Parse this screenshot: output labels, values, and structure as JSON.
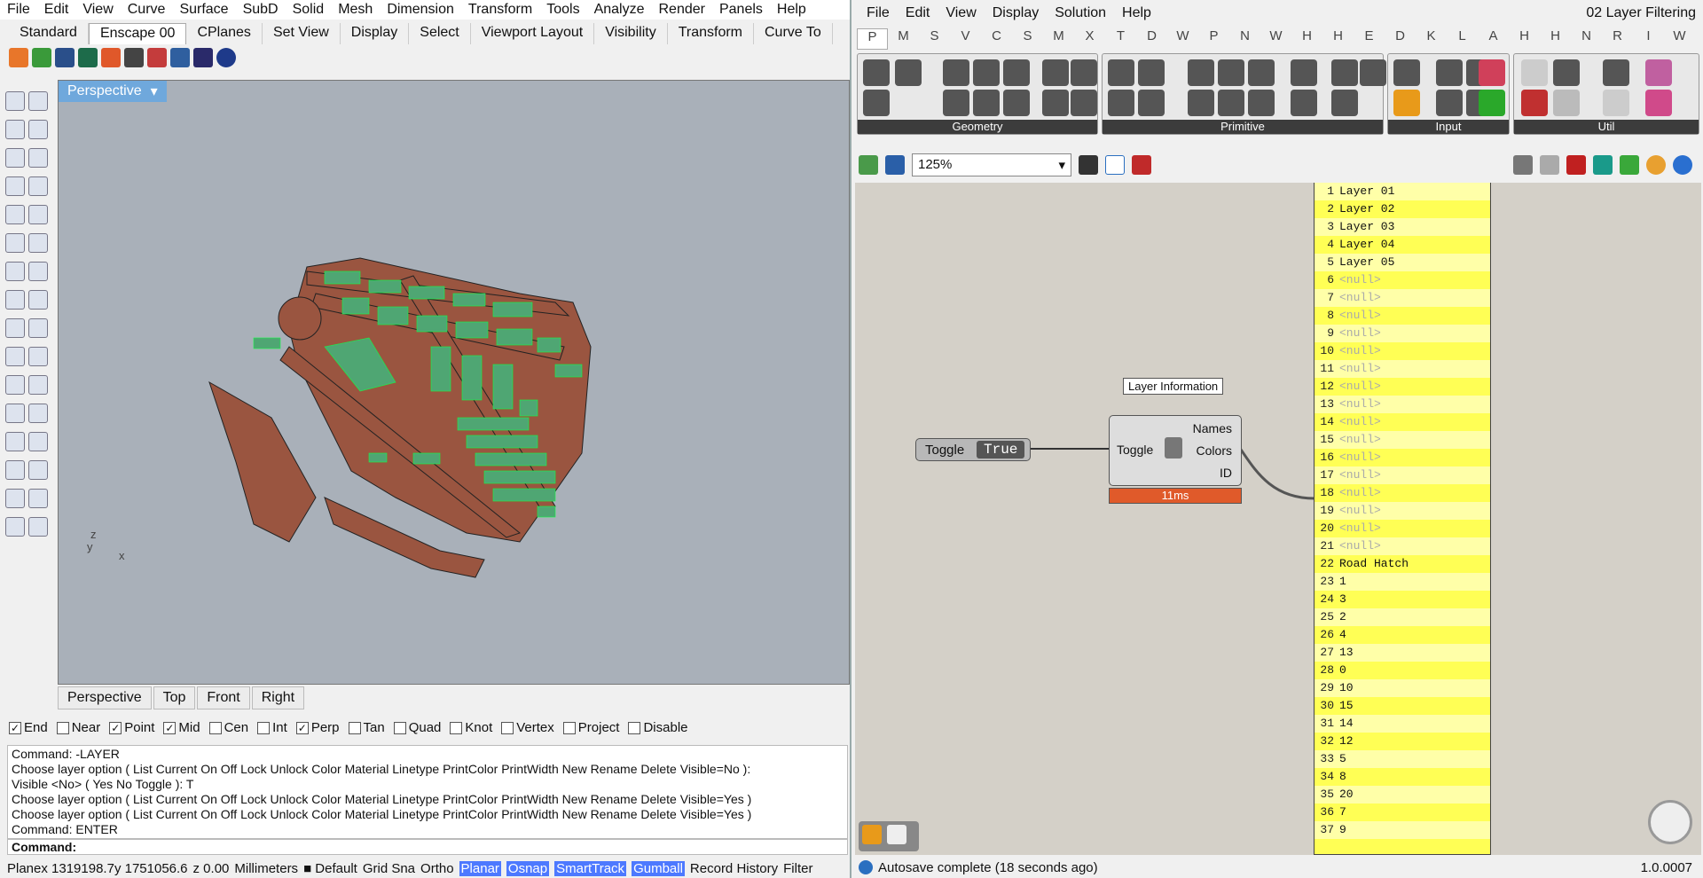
{
  "rhino": {
    "menu": [
      "File",
      "Edit",
      "View",
      "Curve",
      "Surface",
      "SubD",
      "Solid",
      "Mesh",
      "Dimension",
      "Transform",
      "Tools",
      "Analyze",
      "Render",
      "Panels",
      "Help"
    ],
    "tabs": [
      "Standard",
      "Enscape 00",
      "CPlanes",
      "Set View",
      "Display",
      "Select",
      "Viewport Layout",
      "Visibility",
      "Transform",
      "Curve To"
    ],
    "active_tab": "Enscape 00",
    "viewport_title": "Perspective",
    "viewport_tabs": [
      "Perspective",
      "Top",
      "Front",
      "Right"
    ],
    "axis": {
      "z": "z",
      "y": "y",
      "x": "x"
    },
    "osnaps": [
      {
        "label": "End",
        "checked": true
      },
      {
        "label": "Near",
        "checked": false
      },
      {
        "label": "Point",
        "checked": true
      },
      {
        "label": "Mid",
        "checked": true
      },
      {
        "label": "Cen",
        "checked": false
      },
      {
        "label": "Int",
        "checked": false
      },
      {
        "label": "Perp",
        "checked": true
      },
      {
        "label": "Tan",
        "checked": false
      },
      {
        "label": "Quad",
        "checked": false
      },
      {
        "label": "Knot",
        "checked": false
      },
      {
        "label": "Vertex",
        "checked": false
      },
      {
        "label": "Project",
        "checked": false
      },
      {
        "label": "Disable",
        "checked": false
      }
    ],
    "command_history": [
      "Command: -LAYER",
      "Choose layer option ( List  Current  On  Off  Lock  Unlock  Color  Material  Linetype  PrintColor  PrintWidth  New  Rename  Delete  Visible=No ):",
      "Visible <No> ( Yes  No  Toggle ): T",
      "Choose layer option ( List  Current  On  Off  Lock  Unlock  Color  Material  Linetype  PrintColor  PrintWidth  New  Rename  Delete  Visible=Yes )",
      "Choose layer option ( List  Current  On  Off  Lock  Unlock  Color  Material  Linetype  PrintColor  PrintWidth  New  Rename  Delete  Visible=Yes )",
      "Command: ENTER"
    ],
    "command_prompt": "Command:",
    "status": {
      "cplane": "Planex 1319198.7y 1751056.6",
      "z": "z 0.00",
      "units": "Millimeters",
      "layer": "Default",
      "items": [
        "Grid Sna",
        "Ortho"
      ],
      "highlighted": [
        "Planar",
        "Osnap",
        "SmartTrack",
        "Gumball"
      ],
      "tail": [
        "Record History",
        "Filter"
      ]
    }
  },
  "gh": {
    "menu": [
      "File",
      "Edit",
      "View",
      "Display",
      "Solution",
      "Help"
    ],
    "title": "02 Layer Filtering",
    "tabs": [
      "P",
      "M",
      "S",
      "V",
      "C",
      "S",
      "M",
      "X",
      "T",
      "D",
      "W",
      "P",
      "N",
      "W",
      "H",
      "H",
      "E",
      "D",
      "K",
      "L",
      "A",
      "H",
      "H",
      "N",
      "R",
      "I",
      "W"
    ],
    "ribbons": [
      "Geometry",
      "Primitive",
      "Input",
      "Util"
    ],
    "zoom": "125%",
    "toggle": {
      "label": "Toggle",
      "value": "True"
    },
    "component": {
      "tooltip": "Layer Information",
      "input": "Toggle",
      "outputs": [
        "Names",
        "Colors",
        "ID"
      ],
      "time": "11ms"
    },
    "panel_rows": [
      "Layer 01",
      "Layer 02",
      "Layer 03",
      "Layer 04",
      "Layer 05",
      "<null>",
      "<null>",
      "<null>",
      "<null>",
      "<null>",
      "<null>",
      "<null>",
      "<null>",
      "<null>",
      "<null>",
      "<null>",
      "<null>",
      "<null>",
      "<null>",
      "<null>",
      "<null>",
      "Road Hatch",
      "1",
      "3",
      "2",
      "4",
      "13",
      "0",
      "10",
      "15",
      "14",
      "12",
      "5",
      "8",
      "20",
      "7",
      "9"
    ],
    "status": "Autosave complete (18 seconds ago)",
    "version": "1.0.0007"
  },
  "colors": {
    "road": "#9a5540",
    "building": "#4fa673",
    "panel": "#ffff55",
    "timebar": "#e05a2a"
  }
}
